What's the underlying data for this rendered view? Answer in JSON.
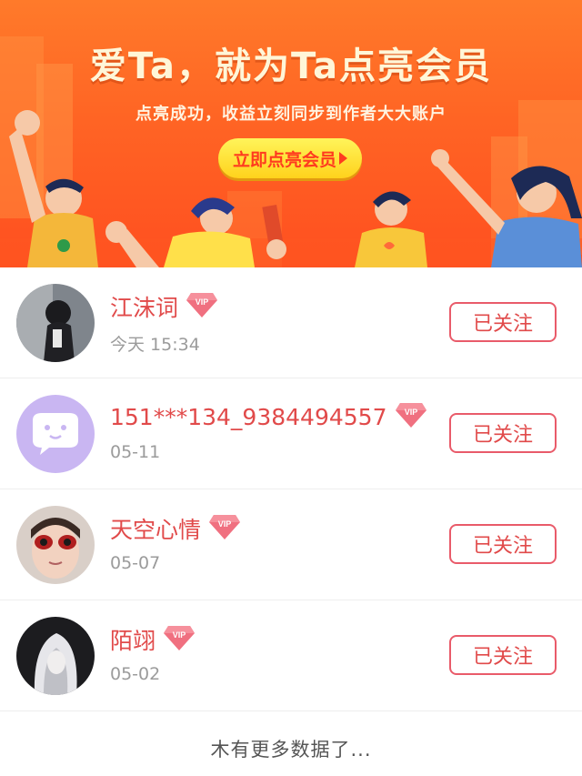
{
  "banner": {
    "title": "爱Ta，就为Ta点亮会员",
    "subtitle": "点亮成功，收益立刻同步到作者大大账户",
    "cta_label": "立即点亮会员"
  },
  "list": {
    "items": [
      {
        "name": "江沫词",
        "date": "今天 15:34",
        "vip": "VIP",
        "follow_label": "已关注",
        "avatar": "avatar-dark-photo"
      },
      {
        "name": "151***134_9384494557",
        "date": "05-11",
        "vip": "VIP",
        "follow_label": "已关注",
        "avatar": "avatar-default-chat"
      },
      {
        "name": "天空心情",
        "date": "05-07",
        "vip": "VIP",
        "follow_label": "已关注",
        "avatar": "avatar-child-photo"
      },
      {
        "name": "陌翊",
        "date": "05-02",
        "vip": "VIP",
        "follow_label": "已关注",
        "avatar": "avatar-white-hair-photo"
      }
    ]
  },
  "footer": {
    "text": "木有更多数据了..."
  },
  "colors": {
    "banner_orange": "#ff6424",
    "accent_red": "#e14a4a",
    "button_border": "#e95b6a",
    "cta_yellow": "#ffd21c",
    "date_gray": "#9b9b9b"
  }
}
